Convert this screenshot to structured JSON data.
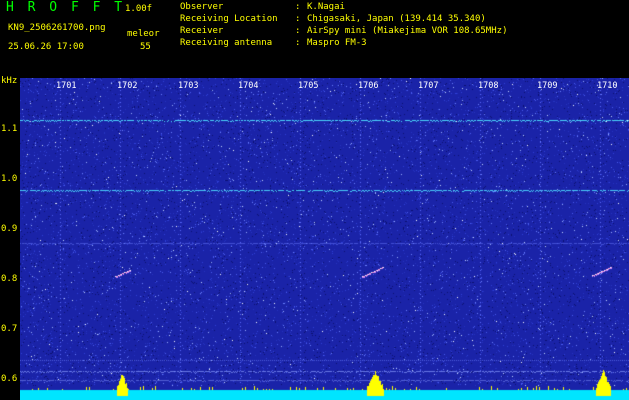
{
  "header": {
    "app_title": "H R O F F T",
    "version": "1.00f",
    "filename": "KN9_2506261700.png",
    "datetime": "25.06.26 17:00",
    "mode_label": "meleor",
    "count_value": "55"
  },
  "info": [
    {
      "key": "Observer",
      "value": "K.Nagai"
    },
    {
      "key": "Receiving Location",
      "value": "Chigasaki, Japan (139.414 35.340)"
    },
    {
      "key": "Receiver",
      "value": "AirSpy mini (Miakejima VOR 108.65MHz)"
    },
    {
      "key": "Receiving antenna",
      "value": "Maspro FM-3"
    }
  ],
  "axes": {
    "unit": "kHz",
    "y_ticks": [
      "1.1",
      "1.0",
      "0.9",
      "0.8",
      "0.7",
      "0.6"
    ],
    "x_ticks": [
      "1701",
      "1702",
      "1703",
      "1704",
      "1705",
      "1706",
      "1707",
      "1708",
      "1709",
      "1710"
    ]
  },
  "colors": {
    "background": "#1a23a8",
    "text_yellow": "#ffff00",
    "title_green": "#00ff00",
    "carrier_line": "#4ee0ff",
    "baseline": "#00e5ff",
    "peak": "#ffff00"
  }
}
